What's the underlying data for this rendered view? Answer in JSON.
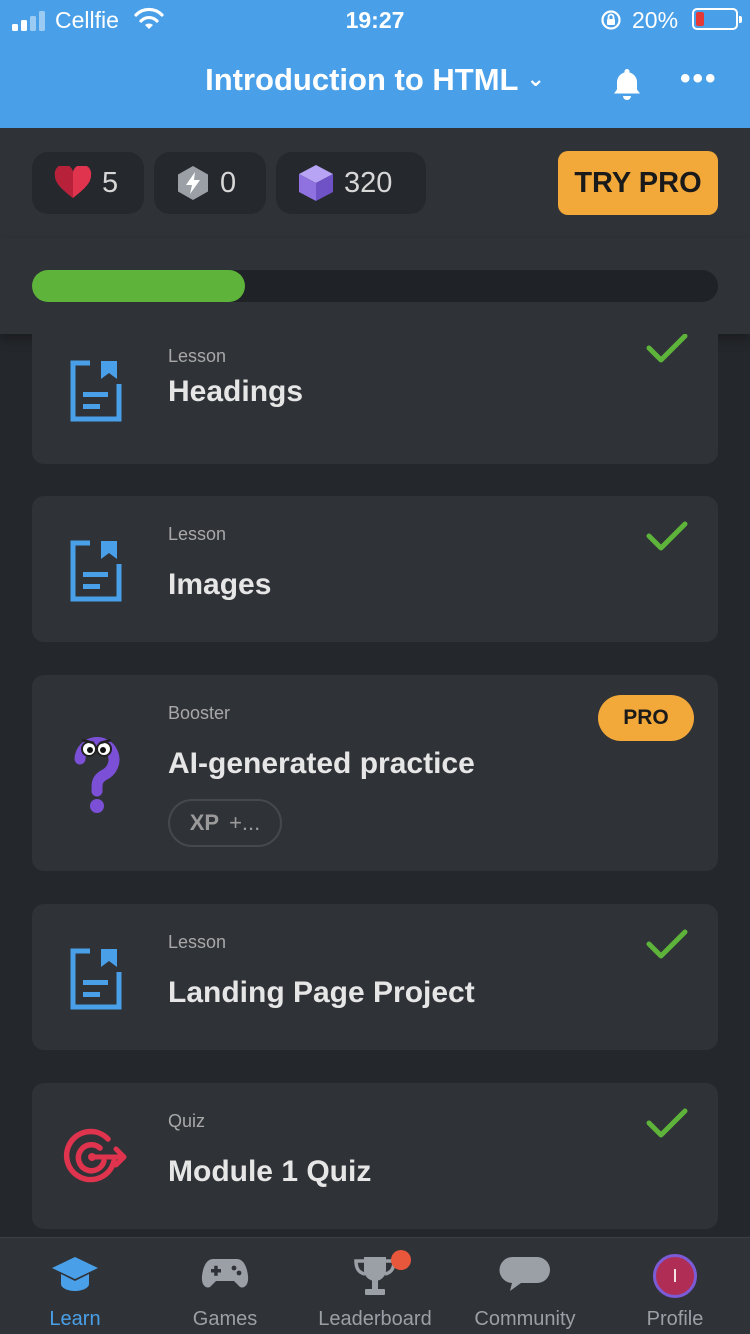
{
  "status_bar": {
    "carrier": "Cellfie",
    "time": "19:27",
    "battery_percent": "20%",
    "battery_level": 0.2,
    "icons": [
      "signal-icon",
      "wifi-icon",
      "rotation-lock-icon",
      "battery-icon"
    ]
  },
  "header": {
    "title": "Introduction to HTML",
    "chevron": "⌄",
    "more": "•••",
    "icons": [
      "chevron-down-icon",
      "bell-icon",
      "more-icon"
    ]
  },
  "stats": {
    "hearts": "5",
    "streak": "0",
    "gems": "320",
    "try_pro": "TRY PRO",
    "icons": [
      "heart-icon",
      "bolt-icon",
      "gem-cube-icon"
    ]
  },
  "progress": {
    "fraction": 0.31,
    "color": "#5eb33a"
  },
  "cards": [
    {
      "type": "Lesson",
      "title": "Headings",
      "icon": "lesson-icon",
      "completed": true
    },
    {
      "type": "Lesson",
      "title": "Images",
      "icon": "lesson-icon",
      "completed": true
    },
    {
      "type": "Booster",
      "title": "AI-generated practice",
      "icon": "question-character-icon",
      "badge": "PRO",
      "xp_label": "XP",
      "xp_value": "+..."
    },
    {
      "type": "Lesson",
      "title": "Landing Page Project",
      "icon": "lesson-icon",
      "completed": true
    },
    {
      "type": "Quiz",
      "title": "Module 1 Quiz",
      "icon": "target-icon",
      "completed": true
    }
  ],
  "nav": [
    {
      "label": "Learn",
      "icon": "graduation-cap-icon",
      "active": true
    },
    {
      "label": "Games",
      "icon": "gamepad-icon"
    },
    {
      "label": "Leaderboard",
      "icon": "trophy-icon",
      "notification": true
    },
    {
      "label": "Community",
      "icon": "chat-bubble-icon"
    },
    {
      "label": "Profile",
      "icon": "avatar-icon",
      "avatar_letter": "I"
    }
  ],
  "colors": {
    "header_blue": "#4aa0e8",
    "background": "#24272b",
    "card": "#2f3237",
    "accent_orange": "#f3a93a",
    "check_green": "#5eb33a",
    "quiz_red": "#e0344e",
    "gem_purple": "#8f72e0"
  }
}
